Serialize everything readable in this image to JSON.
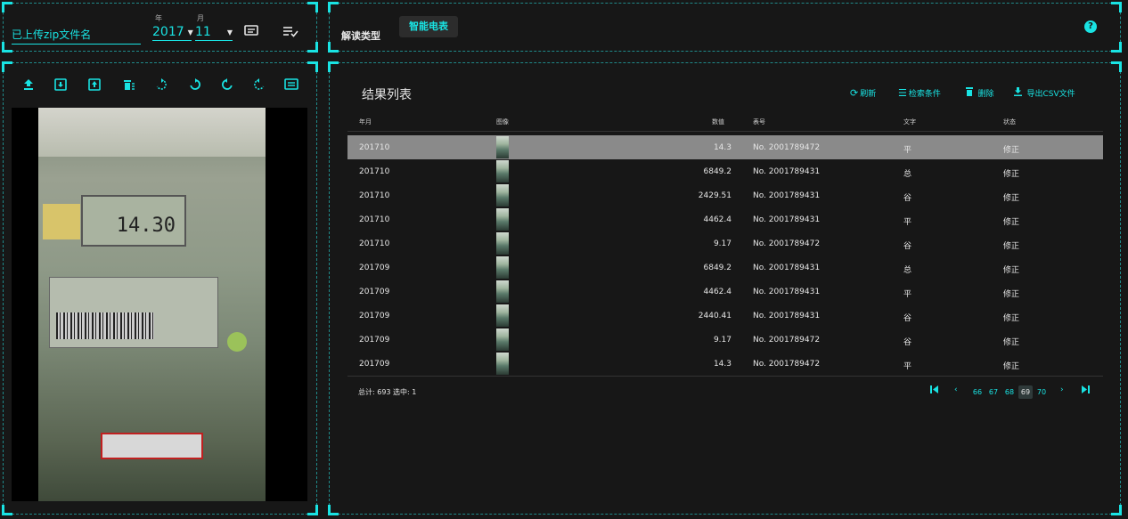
{
  "file": {
    "zip_name": "已上传zip文件名",
    "year_label": "年",
    "month_label": "月",
    "year_value": "2017",
    "month_value": "11"
  },
  "icons": {
    "toolbar_right_a": "list-view-icon",
    "toolbar_right_b": "check-list-icon"
  },
  "read_type": {
    "label": "解读类型",
    "selected": "智能电表",
    "help": "?"
  },
  "viewer": {
    "tools": [
      "upload-icon",
      "download-icon",
      "frame-icon",
      "delete-all-icon",
      "rotate-cw-dashed-icon",
      "rotate-cw-icon",
      "rotate-ccw-icon",
      "rotate-ccw-dashed-icon",
      "subtitles-icon"
    ],
    "lcd_reading": "14.30"
  },
  "results": {
    "title": "结果列表",
    "actions": {
      "refresh": "刷新",
      "search": "检索条件",
      "delete": "删除",
      "export": "导出CSV文件"
    },
    "columns": {
      "year_month": "年月",
      "image": "图像",
      "value": "数值",
      "meter_no": "表号",
      "text": "文字",
      "status": "状态"
    },
    "rows": [
      {
        "year_month": "201710",
        "value": "14.3",
        "meter_no": "No. 2001789472",
        "text": "平",
        "status": "修正",
        "selected": true
      },
      {
        "year_month": "201710",
        "value": "6849.2",
        "meter_no": "No. 2001789431",
        "text": "总",
        "status": "修正"
      },
      {
        "year_month": "201710",
        "value": "2429.51",
        "meter_no": "No. 2001789431",
        "text": "谷",
        "status": "修正"
      },
      {
        "year_month": "201710",
        "value": "4462.4",
        "meter_no": "No. 2001789431",
        "text": "平",
        "status": "修正"
      },
      {
        "year_month": "201710",
        "value": "9.17",
        "meter_no": "No. 2001789472",
        "text": "谷",
        "status": "修正"
      },
      {
        "year_month": "201709",
        "value": "6849.2",
        "meter_no": "No. 2001789431",
        "text": "总",
        "status": "修正"
      },
      {
        "year_month": "201709",
        "value": "4462.4",
        "meter_no": "No. 2001789431",
        "text": "平",
        "status": "修正"
      },
      {
        "year_month": "201709",
        "value": "2440.41",
        "meter_no": "No. 2001789431",
        "text": "谷",
        "status": "修正"
      },
      {
        "year_month": "201709",
        "value": "9.17",
        "meter_no": "No. 2001789472",
        "text": "谷",
        "status": "修正"
      },
      {
        "year_month": "201709",
        "value": "14.3",
        "meter_no": "No. 2001789472",
        "text": "平",
        "status": "修正"
      }
    ],
    "footer": {
      "summary": "总计: 693 选中: 1"
    },
    "pagination": {
      "pages": [
        "66",
        "67",
        "68",
        "69",
        "70"
      ],
      "active": "69"
    }
  },
  "colors": {
    "accent": "#19e3e3",
    "background": "#171717",
    "selected_row": "#8a8a8a"
  }
}
